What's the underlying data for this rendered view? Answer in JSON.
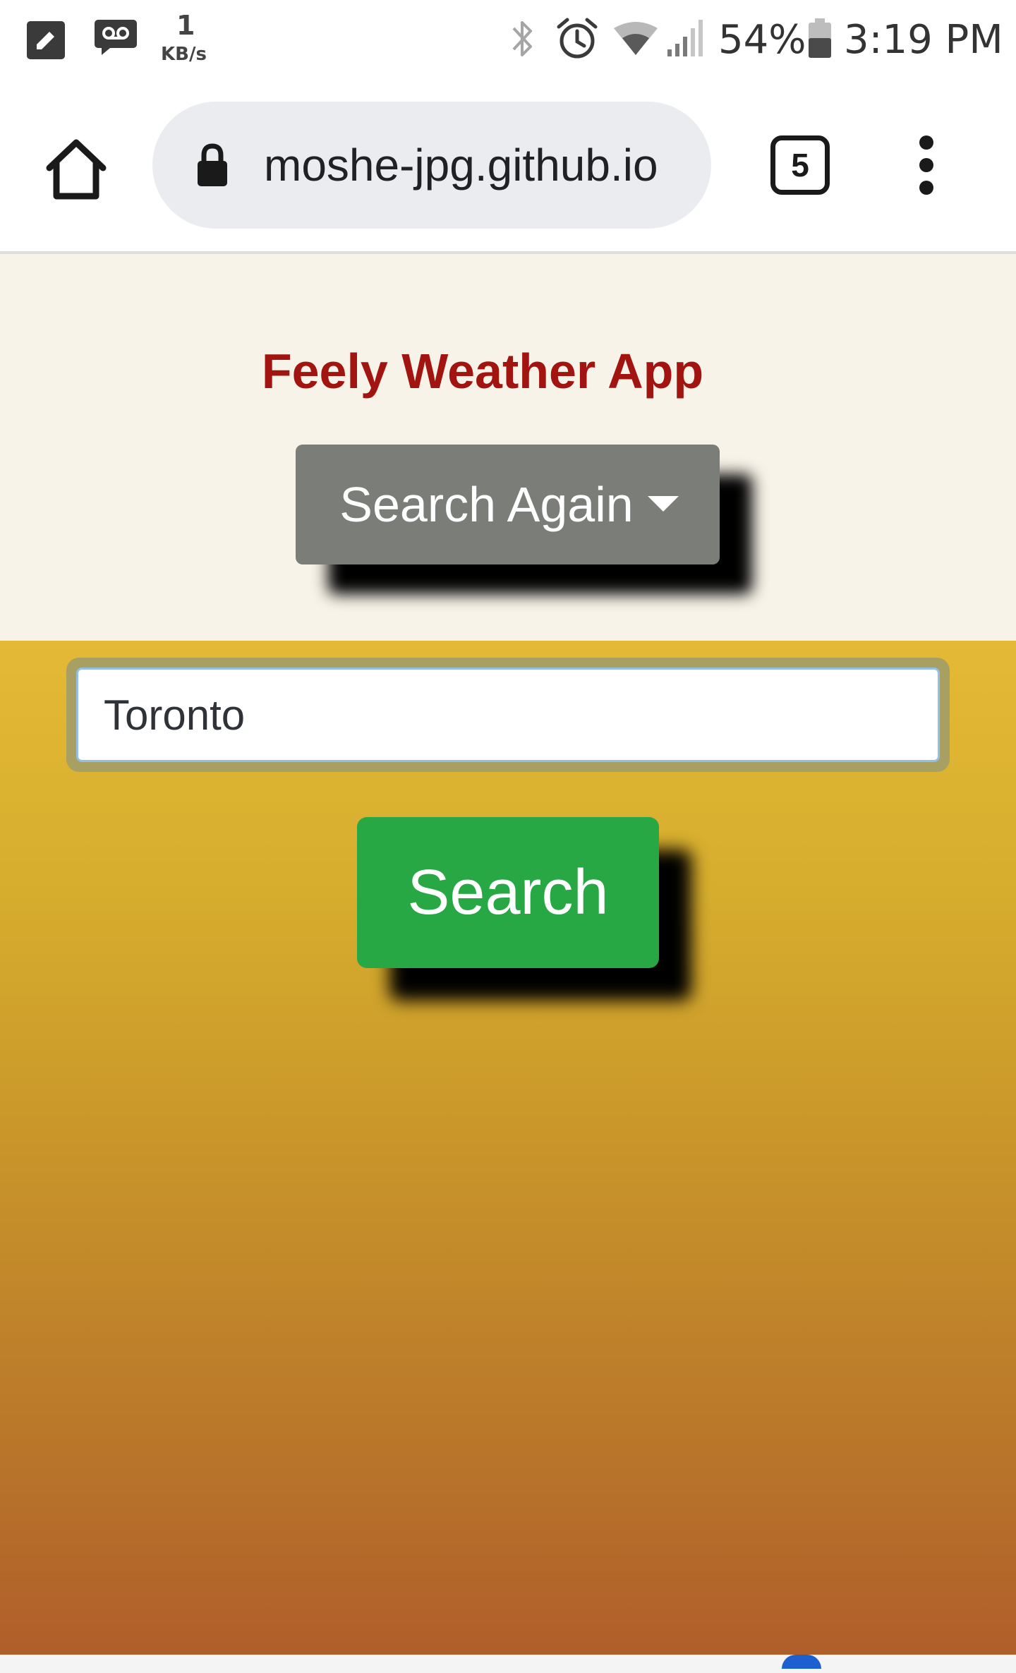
{
  "status_bar": {
    "network_speed_value": "1",
    "network_speed_unit": "KB/s",
    "battery": "54%",
    "time": "3:19 PM",
    "icons": [
      "edit-icon",
      "voicemail-icon",
      "bluetooth-icon",
      "alarm-icon",
      "wifi-icon",
      "signal-icon",
      "battery-icon"
    ]
  },
  "browser": {
    "url": "moshe-jpg.github.io",
    "tab_count": "5",
    "icons": [
      "home-icon",
      "lock-icon",
      "tabs-icon",
      "more-vert-icon"
    ]
  },
  "app": {
    "title": "Feely Weather App",
    "search_again_label": "Search Again",
    "city_input_value": "Toronto",
    "search_label": "Search"
  },
  "colors": {
    "title": "#a11410",
    "search_again_bg": "#7b7d78",
    "search_bg": "#28a745",
    "header_bg": "#f7f3e8",
    "gradient_top": "#e4b937",
    "gradient_bottom": "#b05e2a"
  }
}
